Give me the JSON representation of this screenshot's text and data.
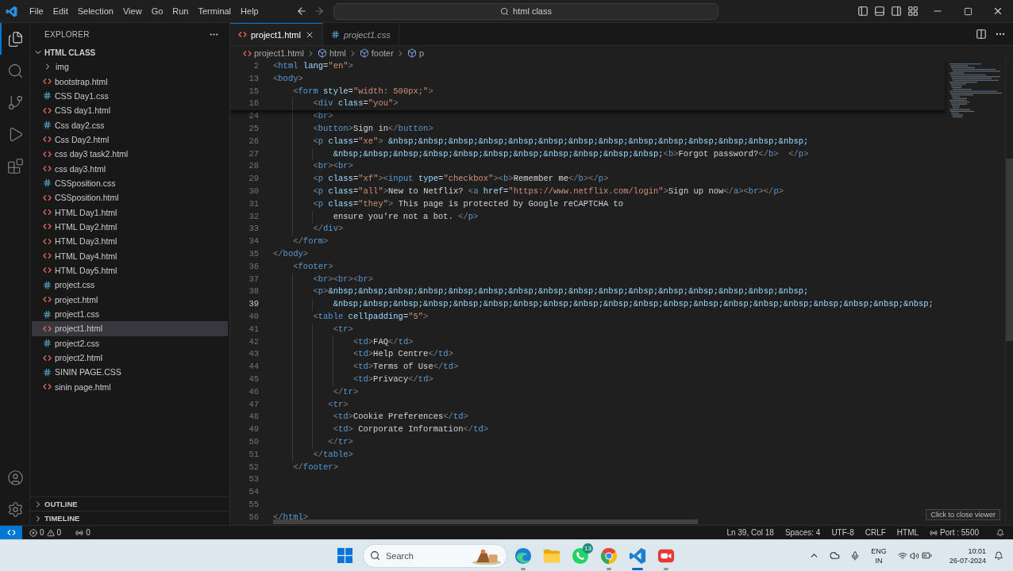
{
  "title_bar": {
    "menu": [
      "File",
      "Edit",
      "Selection",
      "View",
      "Go",
      "Run",
      "Terminal",
      "Help"
    ],
    "command_center": "html class"
  },
  "activity_bar": {
    "items": [
      {
        "kind": "explorer",
        "selected": true
      },
      {
        "kind": "search",
        "selected": false
      },
      {
        "kind": "source_control",
        "selected": false
      },
      {
        "kind": "run_debug",
        "selected": false
      },
      {
        "kind": "extensions",
        "selected": false
      }
    ],
    "bottom": [
      {
        "kind": "accounts"
      },
      {
        "kind": "manage"
      }
    ]
  },
  "sidebar": {
    "title": "EXPLORER",
    "folder": {
      "name": "HTML CLASS",
      "expanded": true,
      "children": [
        {
          "name": "img",
          "kind": "folder",
          "expanded": false,
          "selected": false
        },
        {
          "name": "bootstrap.html",
          "kind": "html",
          "selected": false
        },
        {
          "name": "CSS Day1.css",
          "kind": "css",
          "selected": false
        },
        {
          "name": "CSS day1.html",
          "kind": "html",
          "selected": false
        },
        {
          "name": "Css day2.css",
          "kind": "css",
          "selected": false
        },
        {
          "name": "Css Day2.html",
          "kind": "html",
          "selected": false
        },
        {
          "name": "css day3 task2.html",
          "kind": "html",
          "selected": false
        },
        {
          "name": "css day3.html",
          "kind": "html",
          "selected": false
        },
        {
          "name": "CSSposition.css",
          "kind": "css",
          "selected": false
        },
        {
          "name": "CSSposition.html",
          "kind": "html",
          "selected": false
        },
        {
          "name": "HTML Day1.html",
          "kind": "html",
          "selected": false
        },
        {
          "name": "HTML Day2.html",
          "kind": "html",
          "selected": false
        },
        {
          "name": "HTML Day3.html",
          "kind": "html",
          "selected": false
        },
        {
          "name": "HTML Day4.html",
          "kind": "html",
          "selected": false
        },
        {
          "name": "HTML Day5.html",
          "kind": "html",
          "selected": false
        },
        {
          "name": "project.css",
          "kind": "css",
          "selected": false
        },
        {
          "name": "project.html",
          "kind": "html",
          "selected": false
        },
        {
          "name": "project1.css",
          "kind": "css",
          "selected": false
        },
        {
          "name": "project1.html",
          "kind": "html",
          "selected": true
        },
        {
          "name": "project2.css",
          "kind": "css",
          "selected": false
        },
        {
          "name": "project2.html",
          "kind": "html",
          "selected": false
        },
        {
          "name": "SININ PAGE.CSS",
          "kind": "css",
          "selected": false
        },
        {
          "name": "sinin page.html",
          "kind": "html",
          "selected": false
        }
      ]
    },
    "sections": [
      {
        "name": "OUTLINE",
        "expanded": false
      },
      {
        "name": "TIMELINE",
        "expanded": false
      }
    ]
  },
  "tabs": [
    {
      "label": "project1.html",
      "kind": "html",
      "selected": true,
      "preview": false
    },
    {
      "label": "project1.css",
      "kind": "css",
      "selected": false,
      "preview": true
    }
  ],
  "breadcrumbs": [
    {
      "label": "project1.html",
      "kind": "file"
    },
    {
      "label": "html",
      "kind": "element"
    },
    {
      "label": "footer",
      "kind": "element"
    },
    {
      "label": "p",
      "kind": "element"
    }
  ],
  "editor": {
    "sticky_lines": [
      {
        "number": "2",
        "text": "<html lang=\"en\">"
      },
      {
        "number": "13",
        "text": "<body>"
      },
      {
        "number": "15",
        "text": "    <form style=\"width: 500px;\">"
      },
      {
        "number": "16",
        "text": "        <div class=\"you\">"
      }
    ],
    "lines": [
      {
        "number": "24",
        "text": "        <br>",
        "current": false
      },
      {
        "number": "25",
        "text": "        <button>Sign in</button>",
        "current": false
      },
      {
        "number": "26",
        "text": "        <p class=\"xe\"> &nbsp;&nbsp;&nbsp;&nbsp;&nbsp;&nbsp;&nbsp;&nbsp;&nbsp;&nbsp;&nbsp;&nbsp;&nbsp;&nbsp;",
        "current": false
      },
      {
        "number": "27",
        "text": "            &nbsp;&nbsp;&nbsp;&nbsp;&nbsp;&nbsp;&nbsp;&nbsp;&nbsp;&nbsp;&nbsp;<b>Forgot password?</b>  </p>",
        "current": false
      },
      {
        "number": "28",
        "text": "        <br><br>",
        "current": false
      },
      {
        "number": "29",
        "text": "        <p class=\"xf\"><input type=\"checkbox\"><b>Remember me</b></p>",
        "current": false
      },
      {
        "number": "30",
        "text": "        <p class=\"all\">New to Netflix? <a href=\"https://www.netflix.com/login\">Sign up now</a><br></p>",
        "current": false
      },
      {
        "number": "31",
        "text": "        <p class=\"they\"> This page is protected by Google reCAPTCHA to",
        "current": false
      },
      {
        "number": "32",
        "text": "            ensure you're not a bot. </p>",
        "current": false
      },
      {
        "number": "33",
        "text": "        </div>",
        "current": false
      },
      {
        "number": "34",
        "text": "    </form>",
        "current": false
      },
      {
        "number": "35",
        "text": "</body>",
        "current": false
      },
      {
        "number": "36",
        "text": "    <footer>",
        "current": false
      },
      {
        "number": "37",
        "text": "        <br><br><br>",
        "current": false
      },
      {
        "number": "38",
        "text": "        <p>&nbsp;&nbsp;&nbsp;&nbsp;&nbsp;&nbsp;&nbsp;&nbsp;&nbsp;&nbsp;&nbsp;&nbsp;&nbsp;&nbsp;&nbsp;&nbsp;",
        "current": false
      },
      {
        "number": "39",
        "text": "            &nbsp;&nbsp;&nbsp;&nbsp;&nbsp;&nbsp;&nbsp;&nbsp;&nbsp;&nbsp;&nbsp;&nbsp;&nbsp;&nbsp;&nbsp;&nbsp;&nbsp;&nbsp;&nbsp;&nbsp;",
        "current": true
      },
      {
        "number": "40",
        "text": "        <table cellpadding=\"5\">",
        "current": false
      },
      {
        "number": "41",
        "text": "            <tr>",
        "current": false
      },
      {
        "number": "42",
        "text": "                <td>FAQ</td>",
        "current": false
      },
      {
        "number": "43",
        "text": "                <td>Help Centre</td>",
        "current": false
      },
      {
        "number": "44",
        "text": "                <td>Terms of Use</td>",
        "current": false
      },
      {
        "number": "45",
        "text": "                <td>Privacy</td>",
        "current": false
      },
      {
        "number": "46",
        "text": "            </tr>",
        "current": false
      },
      {
        "number": "47",
        "text": "           <tr>",
        "current": false
      },
      {
        "number": "48",
        "text": "            <td>Cookie Preferences</td>",
        "current": false
      },
      {
        "number": "49",
        "text": "            <td> Corporate Information</td>",
        "current": false
      },
      {
        "number": "50",
        "text": "           </tr>",
        "current": false
      },
      {
        "number": "51",
        "text": "        </table>",
        "current": false
      },
      {
        "number": "52",
        "text": "    </footer>",
        "current": false
      },
      {
        "number": "53",
        "current": false
      },
      {
        "number": "54",
        "current": false
      },
      {
        "number": "55",
        "current": false
      },
      {
        "number": "56",
        "text": "</html>",
        "current": false
      }
    ],
    "hint": "Click to close viewer"
  },
  "status_bar": {
    "errors": "0",
    "warnings": "0",
    "ports": "0",
    "items": [
      {
        "kind": "text",
        "label": "Ln 39, Col 18"
      },
      {
        "kind": "text",
        "label": "Spaces: 4"
      },
      {
        "kind": "text",
        "label": "UTF-8"
      },
      {
        "kind": "text",
        "label": "CRLF"
      },
      {
        "kind": "text",
        "label": "HTML"
      },
      {
        "kind": "port",
        "label": "Port : 5500"
      }
    ]
  },
  "taskbar": {
    "search": {
      "placeholder": "Search"
    },
    "apps": [
      {
        "kind": "edge",
        "open": true,
        "focused": false
      },
      {
        "kind": "file_explorer",
        "open": false,
        "focused": false
      },
      {
        "kind": "whatsapp",
        "open": false,
        "focused": false,
        "badge": "13"
      },
      {
        "kind": "chrome",
        "open": true,
        "focused": false
      },
      {
        "kind": "vscode",
        "open": true,
        "focused": true
      },
      {
        "kind": "camera",
        "open": true,
        "focused": false
      }
    ],
    "tray": {
      "language": "ENG",
      "region": "IN",
      "time": "10:01",
      "date": "26-07-2024"
    }
  }
}
